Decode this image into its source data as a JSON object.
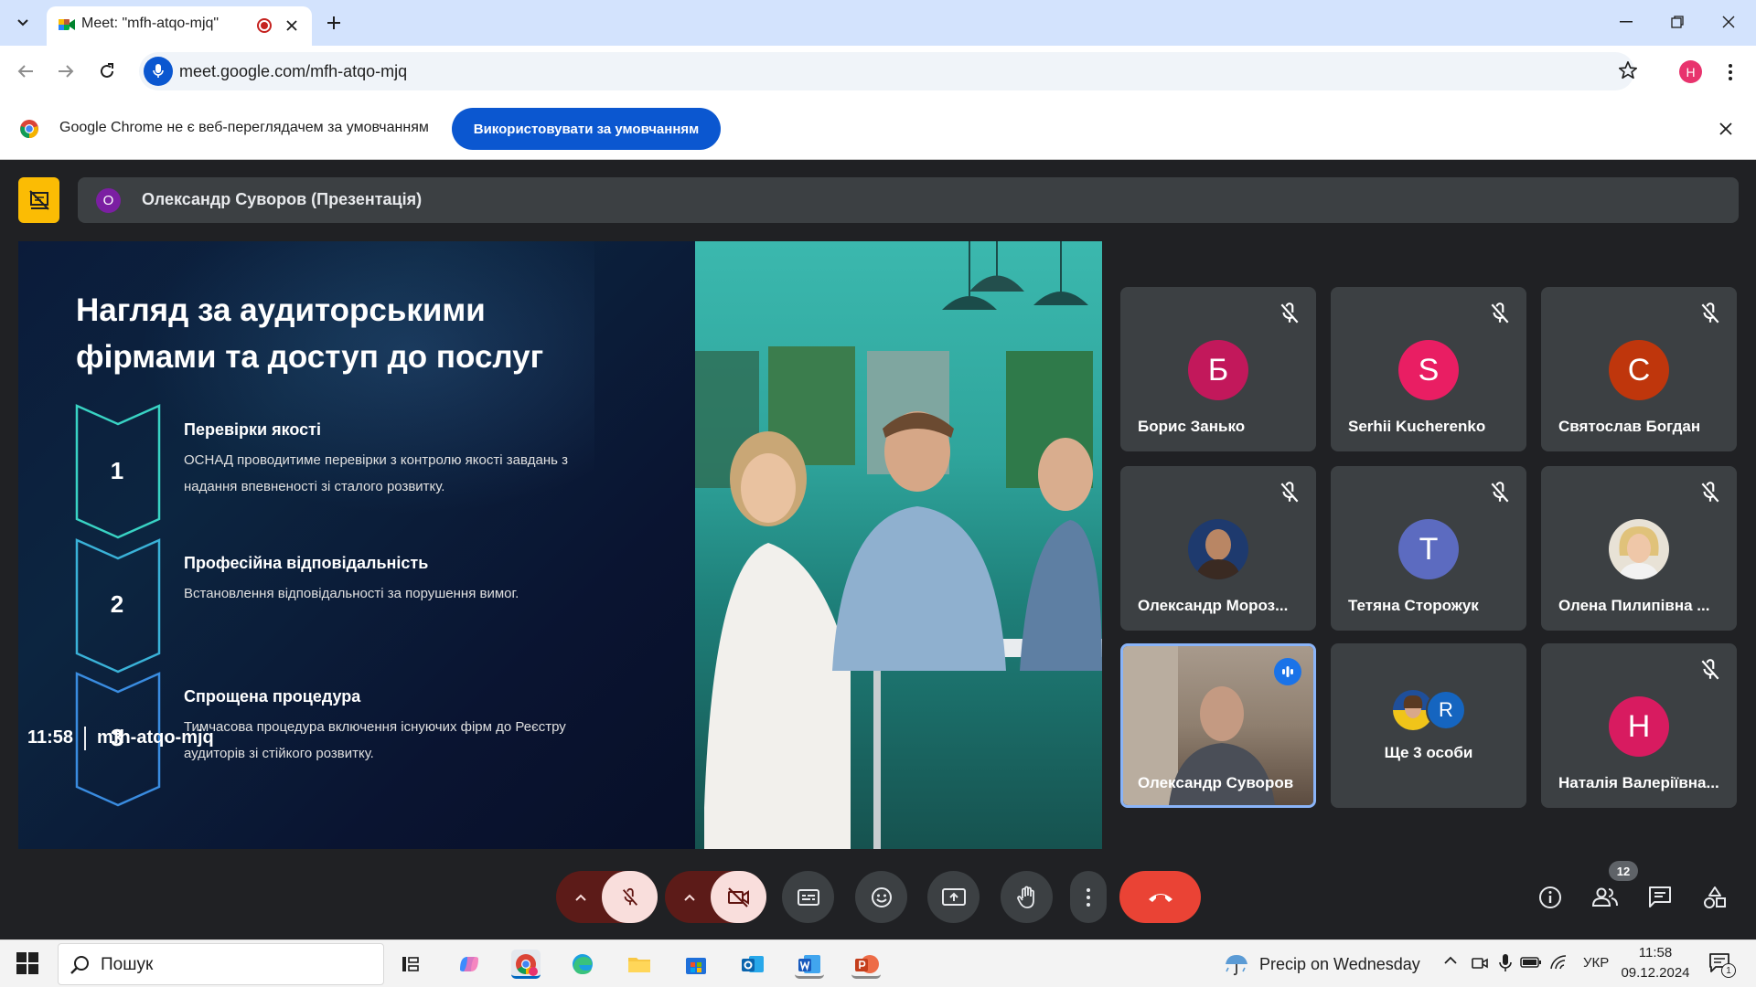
{
  "browser": {
    "tab_title": "Meet: \"mfh-atqo-mjq\"",
    "url": "meet.google.com/mfh-atqo-mjq",
    "profile_initial": "H"
  },
  "infobar": {
    "message": "Google Chrome не є веб-переглядачем за умовчанням",
    "button_label": "Використовувати за умовчанням"
  },
  "presentation": {
    "avatar_initial": "О",
    "title": "Олександр Суворов (Презентація)"
  },
  "slide": {
    "title_line1": "Нагляд за аудиторськими",
    "title_line2": "фірмами та доступ до послуг",
    "steps": [
      {
        "num": "1",
        "heading": "Перевірки якості",
        "desc_line1": "ОСНАД проводитиме перевірки з контролю якості завдань з",
        "desc_line2": "надання впевненості зі сталого розвитку."
      },
      {
        "num": "2",
        "heading": "Професійна відповідальність",
        "desc_line1": "Встановлення відповідальності за порушення вимог.",
        "desc_line2": ""
      },
      {
        "num": "3",
        "heading": "Спрощена процедура",
        "desc_line1": "Тимчасова процедура включення існуючих фірм до Реєстру",
        "desc_line2": "аудиторів зі стійкого розвитку."
      }
    ]
  },
  "participants": [
    {
      "name": "Борис Занько",
      "initial": "Б",
      "color": "#c2185b",
      "muted": true
    },
    {
      "name": "Serhii Kucherenko",
      "initial": "S",
      "color": "#e91e63",
      "muted": true
    },
    {
      "name": "Святослав Богдан",
      "initial": "С",
      "color": "#bf360c",
      "muted": true
    },
    {
      "name": "Олександр Мороз...",
      "initial": "",
      "color": "#1e3a6e",
      "muted": true
    },
    {
      "name": "Тетяна Сторожук",
      "initial": "Т",
      "color": "#5c6bc0",
      "muted": true
    },
    {
      "name": "Олена Пилипівна ...",
      "initial": "",
      "color": "#d9c9b5",
      "muted": true
    },
    {
      "name": "Олександр Суворов",
      "initial": "",
      "color": "#6d5a4a",
      "muted": false,
      "speaking": true
    },
    {
      "name": "Ще 3 особи",
      "initial": "R",
      "color": "#1565c0",
      "muted": false
    },
    {
      "name": "Наталія Валеріївна...",
      "initial": "Н",
      "color": "#d81b60",
      "muted": true
    }
  ],
  "meeting": {
    "time": "11:58",
    "code": "mfh-atqo-mjq",
    "participants_count": "12"
  },
  "taskbar": {
    "search_placeholder": "Пошук",
    "weather": "Precip on Wednesday",
    "language": "УКР",
    "time": "11:58",
    "date": "09.12.2024",
    "notifications": "1"
  },
  "colors": {
    "meet_bg": "#202124",
    "tile_bg": "#3c4043",
    "hangup": "#ea4335",
    "muted_btn": "#f9dedc",
    "accent_blue": "#0b57d0"
  }
}
